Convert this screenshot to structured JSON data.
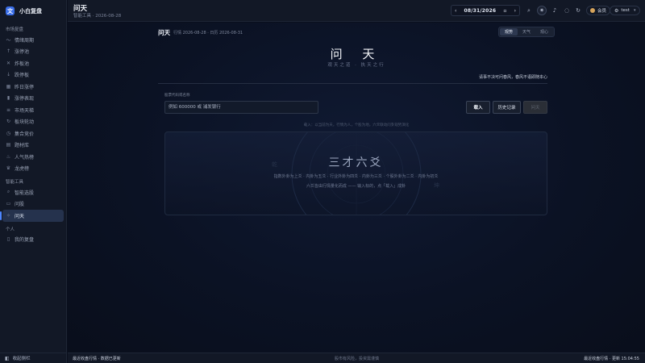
{
  "app": {
    "logo_glyph": "文",
    "name": "小白复盘"
  },
  "sidebar": {
    "sections": [
      {
        "title": "市场复盘",
        "items": [
          {
            "label": "情绪周期",
            "icon": "chart-line-icon"
          },
          {
            "label": "涨停池",
            "icon": "arrow-up-icon"
          },
          {
            "label": "炸板池",
            "icon": "bomb-icon"
          },
          {
            "label": "跌停板",
            "icon": "arrow-down-icon"
          },
          {
            "label": "昨日涨停",
            "icon": "calendar-icon"
          },
          {
            "label": "涨停表现",
            "icon": "bar-chart-icon"
          },
          {
            "label": "市场天梯",
            "icon": "ladder-icon"
          },
          {
            "label": "板块轮动",
            "icon": "rotate-icon"
          },
          {
            "label": "集合竞价",
            "icon": "clock-icon"
          },
          {
            "label": "题材库",
            "icon": "grid-icon"
          },
          {
            "label": "人气热榜",
            "icon": "fire-icon"
          },
          {
            "label": "龙虎榜",
            "icon": "trophy-icon"
          }
        ]
      },
      {
        "title": "智能工具",
        "items": [
          {
            "label": "智能选股",
            "icon": "search-icon"
          },
          {
            "label": "问股",
            "icon": "chat-icon"
          },
          {
            "label": "问天",
            "icon": "sparkle-icon",
            "active": true
          }
        ]
      },
      {
        "title": "个人",
        "items": [
          {
            "label": "我的复盘",
            "icon": "book-icon"
          }
        ]
      }
    ],
    "collapse_label": "收起侧栏"
  },
  "header": {
    "title": "问天",
    "subtitle": "智能工具 · 2026-08-28",
    "date": "08/31/2026",
    "member_label": "会员",
    "user_label": "test"
  },
  "main": {
    "title": "问天",
    "meta": "行情 2026-08-28 · 日历 2026-08-31",
    "tabs": [
      {
        "label": "观势",
        "active": true
      },
      {
        "label": "天气",
        "active": false
      },
      {
        "label": "观心",
        "active": false
      }
    ],
    "hero_title": "问 天",
    "hero_subtitle": "观天之道 · 执天之行",
    "disclaimer": "请事不决可问春风，春风不语即随本心",
    "input_label": "股票代码或名称",
    "input_placeholder": "例如 600000 或 浦发银行",
    "load_label": "载入",
    "history_label": "历史记录",
    "ask_label": "问天",
    "hint": "载入：以当前为天，行情为人，个股为地，六爻联动问卦观势演化",
    "panel": {
      "title": "三才六爻",
      "line1": "指数外卦为上爻 · 内卦为五爻 · 行业外卦为四爻 · 内卦为三爻 · 个股外卦为二爻 · 内卦为初爻",
      "line2": "六爻皆由行情量化而成 —— 输入标的，点「载入」成卦"
    }
  },
  "status": {
    "left": "最近收盘行情 · 数据已更新",
    "mid": "股市有风险，投资需谨慎",
    "right": "最近收盘行情 · 更新 15:04:55"
  },
  "colors": {
    "accent": "#4d86ff",
    "background": "#0a0f1d",
    "sidebar": "#121826",
    "member_dot": "#d6a45c"
  }
}
